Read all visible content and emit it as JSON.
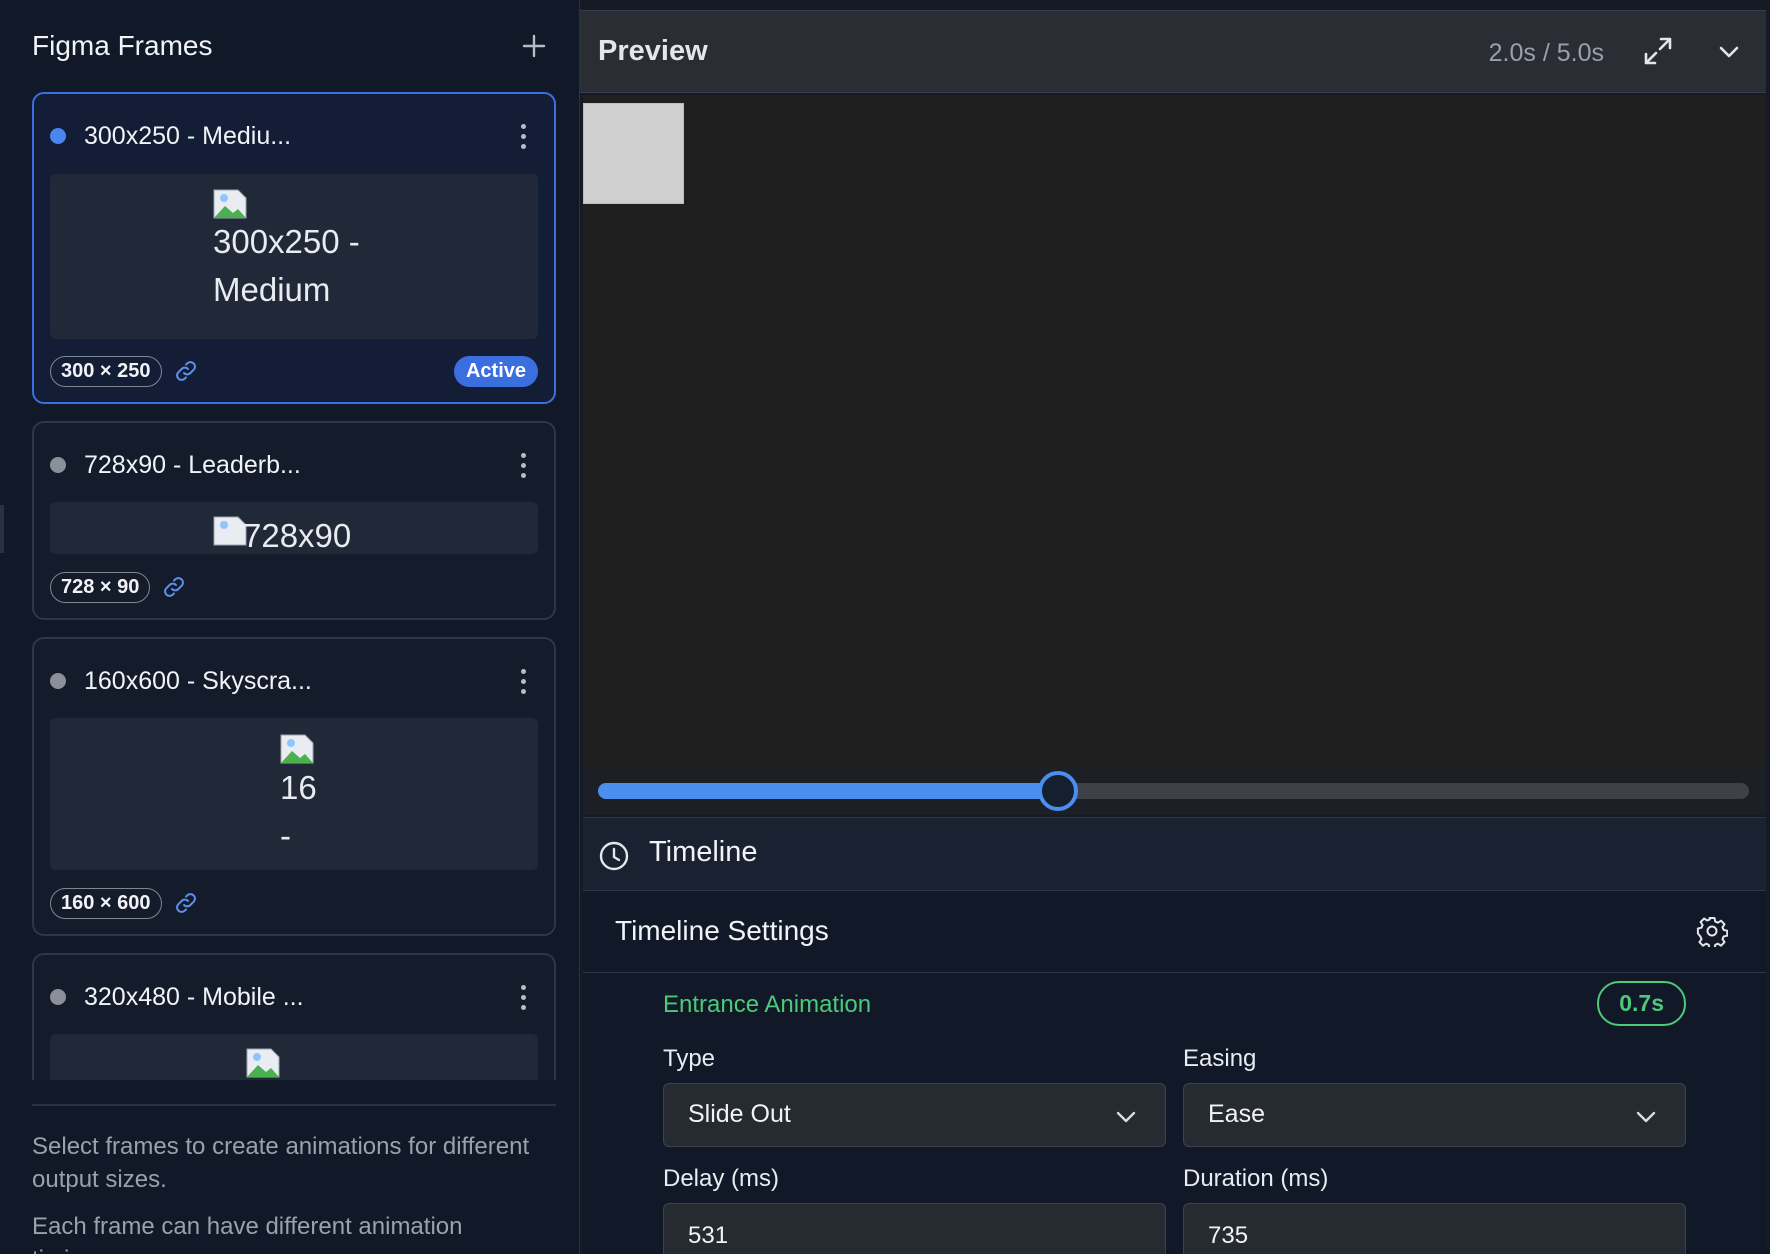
{
  "sidebar": {
    "title": "Figma Frames",
    "frames": [
      {
        "name": "300x250 - Mediu...",
        "alt": "300x250 -\nMedium",
        "dims": "300 × 250",
        "badge": "Active"
      },
      {
        "name": "728x90 - Leaderb...",
        "alt": "728x90",
        "dims": "728 × 90"
      },
      {
        "name": "160x600 - Skyscra...",
        "alt": "16\n-",
        "dims": "160 × 600"
      },
      {
        "name": "320x480 - Mobile ...",
        "alt": "",
        "dims": ""
      }
    ],
    "help_1": "Select frames to create animations for different output sizes.",
    "help_2": "Each frame can have different animation timings."
  },
  "preview": {
    "title": "Preview",
    "time": "2.0s / 5.0s",
    "progress": 0.4
  },
  "timeline": {
    "title": "Timeline",
    "settings_title": "Timeline Settings",
    "section": "Entrance Animation",
    "duration_badge": "0.7s",
    "type_label": "Type",
    "type_value": "Slide Out",
    "easing_label": "Easing",
    "easing_value": "Ease",
    "delay_label": "Delay (ms)",
    "delay_value": "531",
    "duration_label": "Duration (ms)",
    "duration_value": "735"
  },
  "colors": {
    "accent": "#3b6fe0",
    "progress": "#4a8ff0",
    "success": "#4cc97a",
    "panel": "#111827"
  }
}
